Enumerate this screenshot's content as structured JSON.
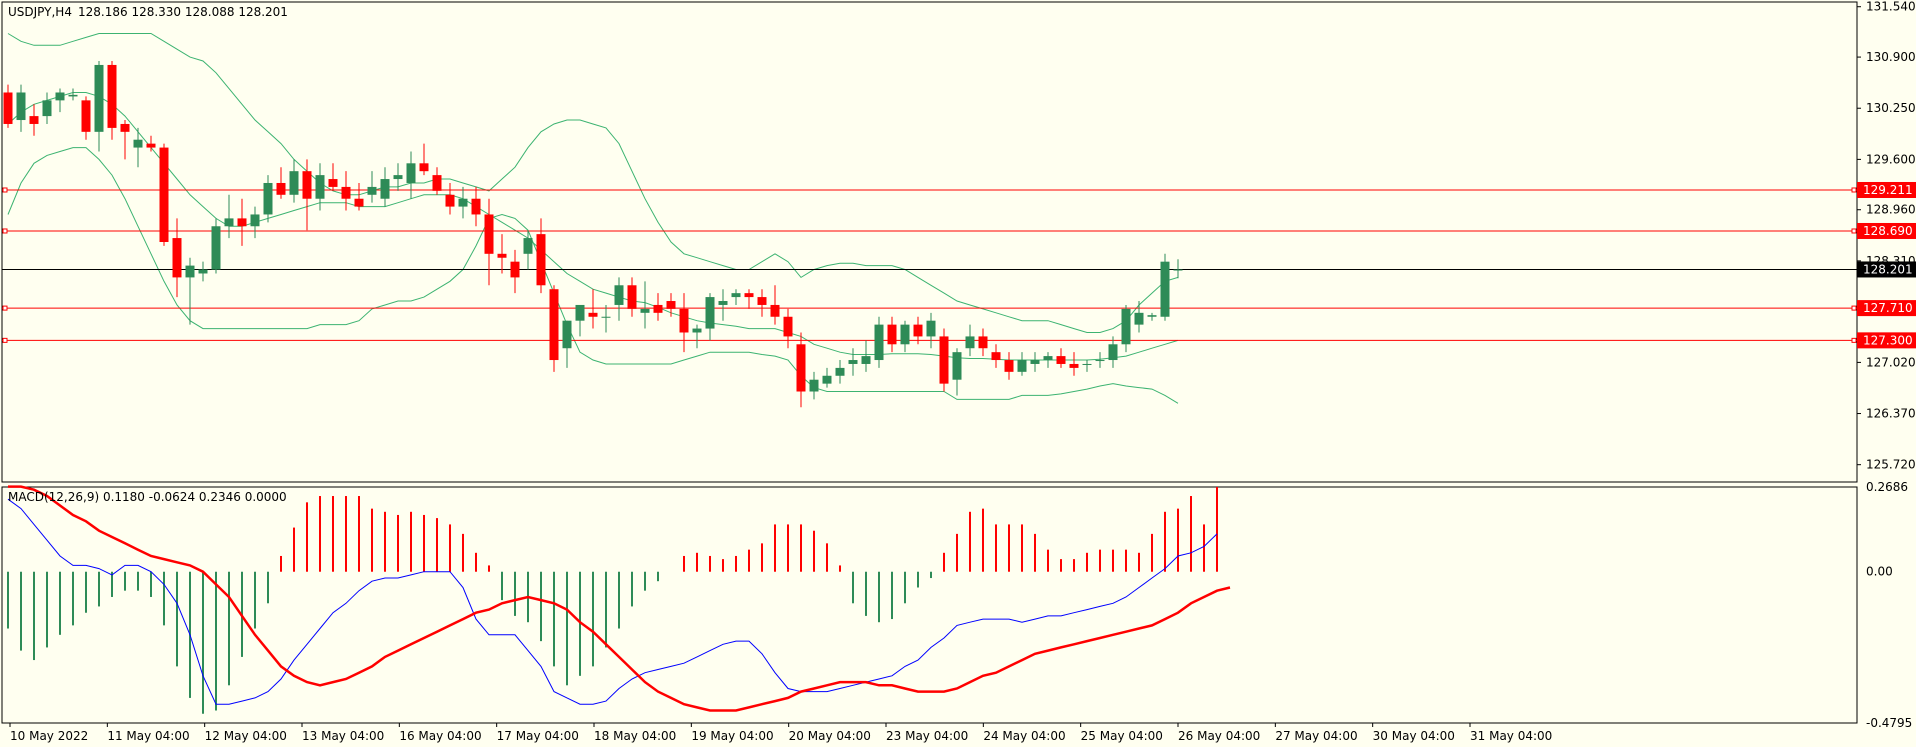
{
  "header": {
    "symbol": "USDJPY,H4",
    "ohlc": "128.186 128.330 128.088 128.201"
  },
  "macd_header": {
    "text": "MACD(12,26,9) 0.1180 -0.0624 0.2346 0.0000"
  },
  "colors": {
    "background": "#fffff0",
    "bull_candle": "#2e8b57",
    "bear_candle": "#ff0000",
    "bands": "#3cb371",
    "level_line": "#ff0000",
    "macd_line": "#0000ff",
    "signal_line": "#ff0000"
  },
  "chart_data": [
    {
      "type": "candlestick",
      "title": "USDJPY,H4",
      "price_ticks": [
        "131.540",
        "130.900",
        "130.250",
        "129.600",
        "128.960",
        "128.310",
        "127.020",
        "126.370",
        "125.720"
      ],
      "ylim": [
        125.5,
        131.6
      ],
      "time_labels": [
        "10 May 2022",
        "11 May 04:00",
        "12 May 04:00",
        "13 May 04:00",
        "16 May 04:00",
        "17 May 04:00",
        "18 May 04:00",
        "19 May 04:00",
        "20 May 04:00",
        "23 May 04:00",
        "24 May 04:00",
        "25 May 04:00",
        "26 May 04:00",
        "27 May 04:00",
        "30 May 04:00",
        "31 May 04:00"
      ],
      "current_price": 128.201,
      "current_price_label": "128.201",
      "levels": [
        {
          "value": 129.211,
          "label": "129.211"
        },
        {
          "value": 128.69,
          "label": "128.690"
        },
        {
          "value": 127.71,
          "label": "127.710"
        },
        {
          "value": 127.3,
          "label": "127.300"
        }
      ],
      "candles": [
        [
          130.45,
          130.55,
          130.0,
          130.05
        ],
        [
          130.1,
          130.55,
          129.95,
          130.45
        ],
        [
          130.15,
          130.3,
          129.9,
          130.05
        ],
        [
          130.15,
          130.45,
          130.05,
          130.35
        ],
        [
          130.35,
          130.5,
          130.2,
          130.45
        ],
        [
          130.4,
          130.5,
          130.35,
          130.42
        ],
        [
          130.35,
          130.4,
          129.85,
          129.95
        ],
        [
          129.95,
          130.85,
          129.7,
          130.8
        ],
        [
          130.8,
          130.85,
          129.85,
          130.0
        ],
        [
          130.05,
          130.1,
          129.6,
          129.95
        ],
        [
          129.75,
          130.0,
          129.5,
          129.85
        ],
        [
          129.8,
          129.9,
          129.7,
          129.75
        ],
        [
          129.75,
          129.8,
          128.5,
          128.55
        ],
        [
          128.6,
          128.85,
          127.85,
          128.1
        ],
        [
          128.1,
          128.35,
          127.5,
          128.25
        ],
        [
          128.15,
          128.3,
          128.05,
          128.2
        ],
        [
          128.2,
          128.85,
          128.15,
          128.75
        ],
        [
          128.75,
          129.15,
          128.6,
          128.85
        ],
        [
          128.85,
          129.1,
          128.5,
          128.75
        ],
        [
          128.75,
          129.0,
          128.6,
          128.9
        ],
        [
          128.9,
          129.4,
          128.8,
          129.3
        ],
        [
          129.3,
          129.5,
          129.1,
          129.15
        ],
        [
          129.15,
          129.6,
          129.05,
          129.45
        ],
        [
          129.45,
          129.6,
          128.7,
          129.1
        ],
        [
          129.1,
          129.55,
          128.95,
          129.4
        ],
        [
          129.35,
          129.55,
          129.2,
          129.25
        ],
        [
          129.25,
          129.45,
          128.95,
          129.1
        ],
        [
          129.1,
          129.3,
          128.95,
          129.0
        ],
        [
          129.15,
          129.45,
          129.05,
          129.25
        ],
        [
          129.1,
          129.5,
          129.0,
          129.35
        ],
        [
          129.35,
          129.55,
          129.2,
          129.4
        ],
        [
          129.3,
          129.7,
          129.1,
          129.55
        ],
        [
          129.55,
          129.8,
          129.4,
          129.45
        ],
        [
          129.4,
          129.5,
          129.15,
          129.2
        ],
        [
          129.15,
          129.3,
          128.9,
          129.0
        ],
        [
          129.0,
          129.25,
          128.85,
          129.1
        ],
        [
          129.1,
          129.25,
          128.75,
          128.9
        ],
        [
          128.9,
          129.1,
          128.0,
          128.4
        ],
        [
          128.4,
          128.65,
          128.15,
          128.35
        ],
        [
          128.3,
          128.45,
          127.9,
          128.1
        ],
        [
          128.4,
          128.7,
          128.2,
          128.6
        ],
        [
          128.65,
          128.85,
          127.9,
          128.0
        ],
        [
          127.95,
          128.0,
          126.9,
          127.05
        ],
        [
          127.2,
          127.55,
          126.95,
          127.55
        ],
        [
          127.55,
          127.75,
          127.35,
          127.75
        ],
        [
          127.65,
          127.95,
          127.45,
          127.6
        ],
        [
          127.6,
          127.75,
          127.4,
          127.6
        ],
        [
          127.75,
          128.1,
          127.55,
          128.0
        ],
        [
          128.0,
          128.1,
          127.6,
          127.7
        ],
        [
          127.65,
          128.05,
          127.45,
          127.7
        ],
        [
          127.75,
          127.9,
          127.55,
          127.65
        ],
        [
          127.8,
          127.9,
          127.6,
          127.7
        ],
        [
          127.7,
          127.9,
          127.15,
          127.4
        ],
        [
          127.4,
          127.5,
          127.2,
          127.45
        ],
        [
          127.45,
          127.9,
          127.3,
          127.85
        ],
        [
          127.75,
          127.95,
          127.55,
          127.8
        ],
        [
          127.85,
          127.95,
          127.75,
          127.9
        ],
        [
          127.9,
          127.95,
          127.7,
          127.85
        ],
        [
          127.85,
          127.95,
          127.6,
          127.75
        ],
        [
          127.75,
          128.0,
          127.5,
          127.6
        ],
        [
          127.6,
          127.7,
          127.2,
          127.35
        ],
        [
          127.25,
          127.4,
          126.45,
          126.65
        ],
        [
          126.65,
          126.9,
          126.55,
          126.8
        ],
        [
          126.75,
          126.95,
          126.7,
          126.85
        ],
        [
          126.85,
          127.05,
          126.75,
          126.95
        ],
        [
          127.0,
          127.2,
          126.85,
          127.05
        ],
        [
          127.0,
          127.3,
          126.9,
          127.1
        ],
        [
          127.05,
          127.6,
          126.95,
          127.5
        ],
        [
          127.5,
          127.6,
          127.15,
          127.25
        ],
        [
          127.25,
          127.55,
          127.15,
          127.5
        ],
        [
          127.5,
          127.6,
          127.25,
          127.35
        ],
        [
          127.35,
          127.65,
          127.2,
          127.55
        ],
        [
          127.35,
          127.45,
          126.65,
          126.75
        ],
        [
          126.8,
          127.2,
          126.6,
          127.15
        ],
        [
          127.2,
          127.5,
          127.1,
          127.35
        ],
        [
          127.35,
          127.45,
          127.1,
          127.2
        ],
        [
          127.15,
          127.25,
          126.95,
          127.05
        ],
        [
          127.05,
          127.15,
          126.8,
          126.9
        ],
        [
          126.9,
          127.15,
          126.85,
          127.05
        ],
        [
          127.0,
          127.15,
          126.9,
          127.05
        ],
        [
          127.05,
          127.15,
          126.95,
          127.1
        ],
        [
          127.1,
          127.2,
          126.95,
          127.0
        ],
        [
          127.0,
          127.15,
          126.85,
          126.95
        ],
        [
          127.0,
          127.05,
          126.9,
          127.0
        ],
        [
          127.05,
          127.15,
          126.95,
          127.05
        ],
        [
          127.05,
          127.35,
          126.95,
          127.25
        ],
        [
          127.25,
          127.75,
          127.15,
          127.7
        ],
        [
          127.5,
          127.8,
          127.4,
          127.65
        ],
        [
          127.6,
          127.65,
          127.55,
          127.62
        ],
        [
          127.6,
          128.4,
          127.55,
          128.3
        ],
        [
          128.19,
          128.33,
          128.09,
          128.2
        ]
      ],
      "upper_band": [
        131.2,
        131.1,
        131.05,
        131.05,
        131.05,
        131.1,
        131.15,
        131.2,
        131.2,
        131.2,
        131.2,
        131.2,
        131.1,
        131.0,
        130.9,
        130.85,
        130.7,
        130.5,
        130.3,
        130.1,
        129.95,
        129.8,
        129.6,
        129.45,
        129.3,
        129.2,
        129.15,
        129.15,
        129.2,
        129.25,
        129.25,
        129.3,
        129.3,
        129.35,
        129.35,
        129.3,
        129.25,
        129.2,
        129.35,
        129.5,
        129.75,
        129.95,
        130.05,
        130.1,
        130.1,
        130.05,
        130.0,
        129.8,
        129.45,
        129.1,
        128.8,
        128.55,
        128.4,
        128.35,
        128.3,
        128.25,
        128.2,
        128.2,
        128.3,
        128.4,
        128.3,
        128.1,
        128.2,
        128.25,
        128.28,
        128.28,
        128.25,
        128.25,
        128.25,
        128.2,
        128.1,
        128.0,
        127.9,
        127.8,
        127.75,
        127.7,
        127.65,
        127.6,
        127.55,
        127.55,
        127.55,
        127.5,
        127.45,
        127.4,
        127.4,
        127.45,
        127.55,
        127.75,
        127.9,
        128.05,
        128.1
      ],
      "middle_band": [
        130.05,
        130.2,
        130.3,
        130.35,
        130.4,
        130.45,
        130.45,
        130.4,
        130.3,
        130.15,
        129.95,
        129.75,
        129.55,
        129.35,
        129.15,
        129.0,
        128.85,
        128.75,
        128.75,
        128.8,
        128.85,
        128.9,
        128.95,
        129.0,
        129.05,
        129.05,
        129.05,
        129.0,
        129.0,
        129.0,
        129.05,
        129.1,
        129.15,
        129.15,
        129.15,
        129.1,
        129.0,
        128.9,
        128.8,
        128.7,
        128.6,
        128.45,
        128.3,
        128.15,
        128.05,
        127.95,
        127.9,
        127.85,
        127.8,
        127.78,
        127.72,
        127.65,
        127.6,
        127.55,
        127.52,
        127.5,
        127.48,
        127.45,
        127.45,
        127.45,
        127.4,
        127.35,
        127.25,
        127.2,
        127.15,
        127.12,
        127.12,
        127.12,
        127.13,
        127.13,
        127.13,
        127.12,
        127.1,
        127.08,
        127.07,
        127.07,
        127.06,
        127.05,
        127.05,
        127.05,
        127.05,
        127.05,
        127.05,
        127.05,
        127.06,
        127.08,
        127.1,
        127.15,
        127.2,
        127.25,
        127.3
      ],
      "lower_band": [
        128.9,
        129.3,
        129.55,
        129.65,
        129.7,
        129.75,
        129.75,
        129.6,
        129.4,
        129.1,
        128.75,
        128.4,
        128.05,
        127.75,
        127.55,
        127.45,
        127.45,
        127.45,
        127.45,
        127.45,
        127.45,
        127.45,
        127.45,
        127.45,
        127.5,
        127.5,
        127.5,
        127.55,
        127.7,
        127.75,
        127.8,
        127.8,
        127.85,
        127.95,
        128.05,
        128.2,
        128.5,
        128.85,
        128.9,
        128.85,
        128.7,
        128.3,
        127.9,
        127.5,
        127.15,
        127.05,
        127.0,
        127.0,
        127.0,
        127.0,
        127.0,
        127.0,
        127.05,
        127.1,
        127.15,
        127.15,
        127.15,
        127.15,
        127.12,
        127.1,
        127.05,
        126.85,
        126.7,
        126.65,
        126.65,
        126.65,
        126.65,
        126.65,
        126.65,
        126.65,
        126.65,
        126.65,
        126.65,
        126.55,
        126.55,
        126.55,
        126.55,
        126.55,
        126.6,
        126.6,
        126.6,
        126.62,
        126.65,
        126.68,
        126.72,
        126.75,
        126.72,
        126.7,
        126.68,
        126.6,
        126.5
      ]
    },
    {
      "type": "macd",
      "title": "MACD(12,26,9)",
      "ylim": [
        -0.4795,
        0.2686
      ],
      "ticks": [
        "0.2686",
        "0.00",
        "-0.4795"
      ],
      "histogram": [
        -0.18,
        -0.25,
        -0.28,
        -0.24,
        -0.2,
        -0.17,
        -0.13,
        -0.11,
        -0.08,
        -0.06,
        -0.06,
        -0.08,
        -0.17,
        -0.3,
        -0.4,
        -0.45,
        -0.44,
        -0.36,
        -0.27,
        -0.18,
        -0.1,
        0.05,
        0.14,
        0.22,
        0.24,
        0.24,
        0.24,
        0.24,
        0.2,
        0.19,
        0.18,
        0.19,
        0.18,
        0.17,
        0.15,
        0.12,
        0.06,
        0.02,
        -0.09,
        -0.14,
        -0.16,
        -0.22,
        -0.3,
        -0.36,
        -0.33,
        -0.3,
        -0.24,
        -0.18,
        -0.11,
        -0.06,
        -0.03,
        0.0,
        0.05,
        0.06,
        0.05,
        0.04,
        0.05,
        0.07,
        0.09,
        0.15,
        0.15,
        0.15,
        0.13,
        0.09,
        0.02,
        -0.1,
        -0.14,
        -0.16,
        -0.15,
        -0.1,
        -0.05,
        -0.02,
        0.06,
        0.12,
        0.19,
        0.2,
        0.15,
        0.15,
        0.15,
        0.12,
        0.07,
        0.04,
        0.04,
        0.06,
        0.07,
        0.07,
        0.07,
        0.06,
        0.12,
        0.19,
        0.2,
        0.24,
        0.15,
        0.2686
      ],
      "macd_line": [
        0.23,
        0.2,
        0.15,
        0.1,
        0.05,
        0.02,
        0.02,
        0.01,
        -0.01,
        0.02,
        0.02,
        0.0,
        -0.04,
        -0.1,
        -0.2,
        -0.33,
        -0.42,
        -0.42,
        -0.41,
        -0.4,
        -0.38,
        -0.34,
        -0.28,
        -0.23,
        -0.18,
        -0.13,
        -0.1,
        -0.06,
        -0.03,
        -0.02,
        -0.02,
        -0.01,
        0.0,
        0.0,
        0.0,
        -0.05,
        -0.15,
        -0.2,
        -0.2,
        -0.2,
        -0.25,
        -0.3,
        -0.38,
        -0.4,
        -0.42,
        -0.42,
        -0.41,
        -0.37,
        -0.34,
        -0.32,
        -0.31,
        -0.3,
        -0.29,
        -0.27,
        -0.25,
        -0.23,
        -0.22,
        -0.22,
        -0.26,
        -0.32,
        -0.37,
        -0.38,
        -0.38,
        -0.38,
        -0.37,
        -0.36,
        -0.35,
        -0.34,
        -0.33,
        -0.3,
        -0.28,
        -0.24,
        -0.21,
        -0.17,
        -0.16,
        -0.15,
        -0.15,
        -0.15,
        -0.16,
        -0.15,
        -0.14,
        -0.14,
        -0.13,
        -0.12,
        -0.11,
        -0.1,
        -0.08,
        -0.05,
        -0.02,
        0.01,
        0.05,
        0.06,
        0.08,
        0.12
      ],
      "signal_line": [
        0.27,
        0.27,
        0.26,
        0.24,
        0.21,
        0.18,
        0.16,
        0.13,
        0.11,
        0.09,
        0.07,
        0.05,
        0.04,
        0.03,
        0.02,
        0.0,
        -0.04,
        -0.08,
        -0.14,
        -0.2,
        -0.25,
        -0.3,
        -0.33,
        -0.35,
        -0.36,
        -0.35,
        -0.34,
        -0.32,
        -0.3,
        -0.27,
        -0.25,
        -0.23,
        -0.21,
        -0.19,
        -0.17,
        -0.15,
        -0.13,
        -0.12,
        -0.1,
        -0.09,
        -0.08,
        -0.09,
        -0.1,
        -0.12,
        -0.16,
        -0.19,
        -0.23,
        -0.27,
        -0.31,
        -0.35,
        -0.38,
        -0.4,
        -0.42,
        -0.43,
        -0.44,
        -0.44,
        -0.44,
        -0.43,
        -0.42,
        -0.41,
        -0.4,
        -0.38,
        -0.37,
        -0.36,
        -0.35,
        -0.35,
        -0.35,
        -0.36,
        -0.36,
        -0.37,
        -0.38,
        -0.38,
        -0.38,
        -0.37,
        -0.35,
        -0.33,
        -0.32,
        -0.3,
        -0.28,
        -0.26,
        -0.25,
        -0.24,
        -0.23,
        -0.22,
        -0.21,
        -0.2,
        -0.19,
        -0.18,
        -0.17,
        -0.15,
        -0.13,
        -0.1,
        -0.08,
        -0.06,
        -0.05
      ]
    }
  ]
}
